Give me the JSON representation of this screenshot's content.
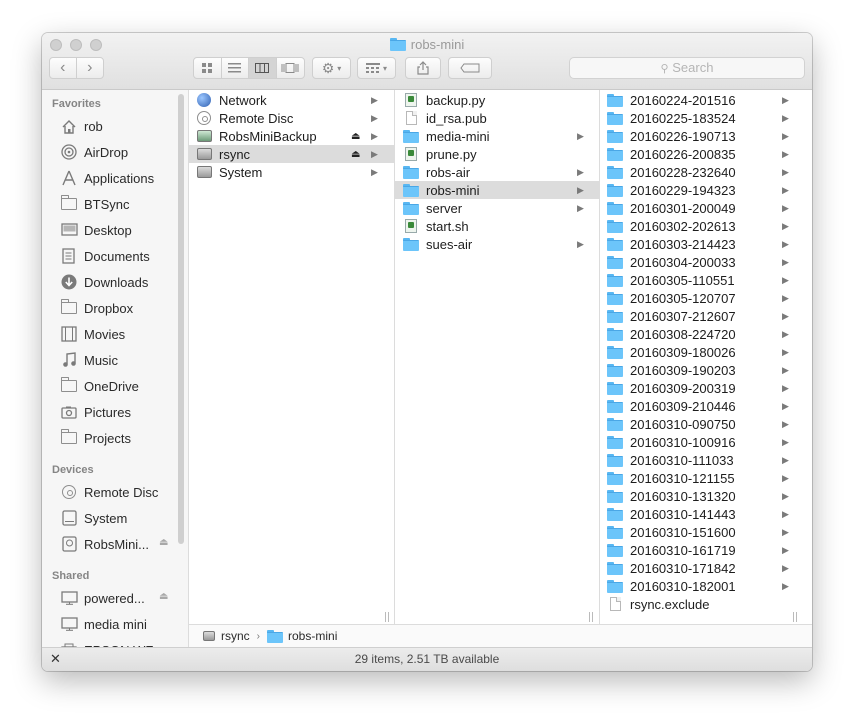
{
  "window": {
    "title": "robs-mini"
  },
  "toolbar": {
    "back_label": "‹",
    "forward_label": "›",
    "search_placeholder": "Search"
  },
  "sidebar": {
    "favorites_header": "Favorites",
    "favorites": [
      {
        "label": "rob",
        "icon": "home-icon"
      },
      {
        "label": "AirDrop",
        "icon": "airdrop-icon"
      },
      {
        "label": "Applications",
        "icon": "applications-icon"
      },
      {
        "label": "BTSync",
        "icon": "folder-icon"
      },
      {
        "label": "Desktop",
        "icon": "desktop-icon"
      },
      {
        "label": "Documents",
        "icon": "documents-icon"
      },
      {
        "label": "Downloads",
        "icon": "downloads-icon"
      },
      {
        "label": "Dropbox",
        "icon": "folder-icon"
      },
      {
        "label": "Movies",
        "icon": "movies-icon"
      },
      {
        "label": "Music",
        "icon": "music-icon"
      },
      {
        "label": "OneDrive",
        "icon": "folder-icon"
      },
      {
        "label": "Pictures",
        "icon": "pictures-icon"
      },
      {
        "label": "Projects",
        "icon": "folder-icon"
      }
    ],
    "devices_header": "Devices",
    "devices": [
      {
        "label": "Remote Disc",
        "icon": "disc-icon"
      },
      {
        "label": "System",
        "icon": "drive-icon"
      },
      {
        "label": "RobsMini...",
        "icon": "backup-drive-icon"
      }
    ],
    "shared_header": "Shared",
    "shared": [
      {
        "label": "powered...",
        "icon": "display-icon"
      },
      {
        "label": "media mini",
        "icon": "display-icon"
      },
      {
        "label": "EPSON WF...",
        "icon": "printer-icon"
      }
    ]
  },
  "columns": [
    {
      "items": [
        {
          "label": "Network",
          "icon": "globe-icon",
          "arrow": true
        },
        {
          "label": "Remote Disc",
          "icon": "disc-icon",
          "arrow": true
        },
        {
          "label": "RobsMiniBackup",
          "icon": "backup-drive-icon",
          "arrow": true,
          "eject": true
        },
        {
          "label": "rsync",
          "icon": "drive-icon",
          "arrow": true,
          "eject": true,
          "selected": true
        },
        {
          "label": "System",
          "icon": "drive-icon",
          "arrow": true
        }
      ]
    },
    {
      "items": [
        {
          "label": "backup.py",
          "icon": "script-icon"
        },
        {
          "label": "id_rsa.pub",
          "icon": "document-icon"
        },
        {
          "label": "media-mini",
          "icon": "folder-icon",
          "arrow": true
        },
        {
          "label": "prune.py",
          "icon": "script-icon"
        },
        {
          "label": "robs-air",
          "icon": "folder-icon",
          "arrow": true
        },
        {
          "label": "robs-mini",
          "icon": "folder-icon",
          "arrow": true,
          "selected": true
        },
        {
          "label": "server",
          "icon": "folder-icon",
          "arrow": true
        },
        {
          "label": "start.sh",
          "icon": "script-icon"
        },
        {
          "label": "sues-air",
          "icon": "folder-icon",
          "arrow": true
        }
      ]
    },
    {
      "items": [
        {
          "label": "20160224-201516",
          "icon": "folder-icon",
          "arrow": true
        },
        {
          "label": "20160225-183524",
          "icon": "folder-icon",
          "arrow": true
        },
        {
          "label": "20160226-190713",
          "icon": "folder-icon",
          "arrow": true
        },
        {
          "label": "20160226-200835",
          "icon": "folder-icon",
          "arrow": true
        },
        {
          "label": "20160228-232640",
          "icon": "folder-icon",
          "arrow": true
        },
        {
          "label": "20160229-194323",
          "icon": "folder-icon",
          "arrow": true
        },
        {
          "label": "20160301-200049",
          "icon": "folder-icon",
          "arrow": true
        },
        {
          "label": "20160302-202613",
          "icon": "folder-icon",
          "arrow": true
        },
        {
          "label": "20160303-214423",
          "icon": "folder-icon",
          "arrow": true
        },
        {
          "label": "20160304-200033",
          "icon": "folder-icon",
          "arrow": true
        },
        {
          "label": "20160305-110551",
          "icon": "folder-icon",
          "arrow": true
        },
        {
          "label": "20160305-120707",
          "icon": "folder-icon",
          "arrow": true
        },
        {
          "label": "20160307-212607",
          "icon": "folder-icon",
          "arrow": true
        },
        {
          "label": "20160308-224720",
          "icon": "folder-icon",
          "arrow": true
        },
        {
          "label": "20160309-180026",
          "icon": "folder-icon",
          "arrow": true
        },
        {
          "label": "20160309-190203",
          "icon": "folder-icon",
          "arrow": true
        },
        {
          "label": "20160309-200319",
          "icon": "folder-icon",
          "arrow": true
        },
        {
          "label": "20160309-210446",
          "icon": "folder-icon",
          "arrow": true
        },
        {
          "label": "20160310-090750",
          "icon": "folder-icon",
          "arrow": true
        },
        {
          "label": "20160310-100916",
          "icon": "folder-icon",
          "arrow": true
        },
        {
          "label": "20160310-111033",
          "icon": "folder-icon",
          "arrow": true
        },
        {
          "label": "20160310-121155",
          "icon": "folder-icon",
          "arrow": true
        },
        {
          "label": "20160310-131320",
          "icon": "folder-icon",
          "arrow": true
        },
        {
          "label": "20160310-141443",
          "icon": "folder-icon",
          "arrow": true
        },
        {
          "label": "20160310-151600",
          "icon": "folder-icon",
          "arrow": true
        },
        {
          "label": "20160310-161719",
          "icon": "folder-icon",
          "arrow": true
        },
        {
          "label": "20160310-171842",
          "icon": "folder-icon",
          "arrow": true
        },
        {
          "label": "20160310-182001",
          "icon": "folder-icon",
          "arrow": true
        },
        {
          "label": "rsync.exclude",
          "icon": "document-icon"
        }
      ]
    }
  ],
  "pathbar": {
    "root": "rsync",
    "separator": "›",
    "current": "robs-mini"
  },
  "status": {
    "text": "29 items, 2.51 TB available"
  },
  "colors": {
    "folder_blue": "#6cc5fa",
    "selection_gray": "#dcdcdc",
    "sidebar_bg": "#f6f6f6"
  }
}
